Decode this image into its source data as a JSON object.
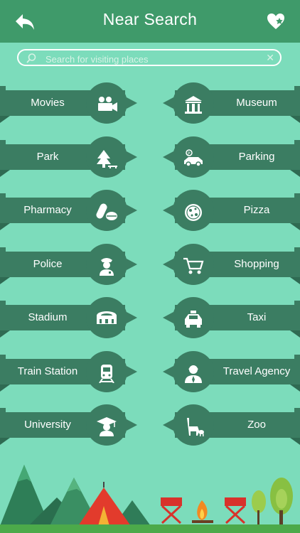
{
  "header": {
    "title": "Near Search"
  },
  "search": {
    "placeholder": "Search for visiting places"
  },
  "categories": {
    "left": [
      {
        "label": "Movies",
        "icon": "movie-camera-icon"
      },
      {
        "label": "Park",
        "icon": "tree-icon"
      },
      {
        "label": "Pharmacy",
        "icon": "pill-icon"
      },
      {
        "label": "Police",
        "icon": "police-officer-icon"
      },
      {
        "label": "Stadium",
        "icon": "stadium-icon"
      },
      {
        "label": "Train Station",
        "icon": "train-icon"
      },
      {
        "label": "University",
        "icon": "graduate-icon"
      }
    ],
    "right": [
      {
        "label": "Museum",
        "icon": "museum-icon"
      },
      {
        "label": "Parking",
        "icon": "parking-car-icon"
      },
      {
        "label": "Pizza",
        "icon": "pizza-icon"
      },
      {
        "label": "Shopping",
        "icon": "shopping-cart-icon"
      },
      {
        "label": "Taxi",
        "icon": "taxi-icon"
      },
      {
        "label": "Travel Agency",
        "icon": "travel-agent-icon"
      },
      {
        "label": "Zoo",
        "icon": "giraffe-icon"
      }
    ]
  },
  "colors": {
    "background": "#7cdcbb",
    "header": "#3f9a6a",
    "ribbon": "#3b7d62"
  }
}
